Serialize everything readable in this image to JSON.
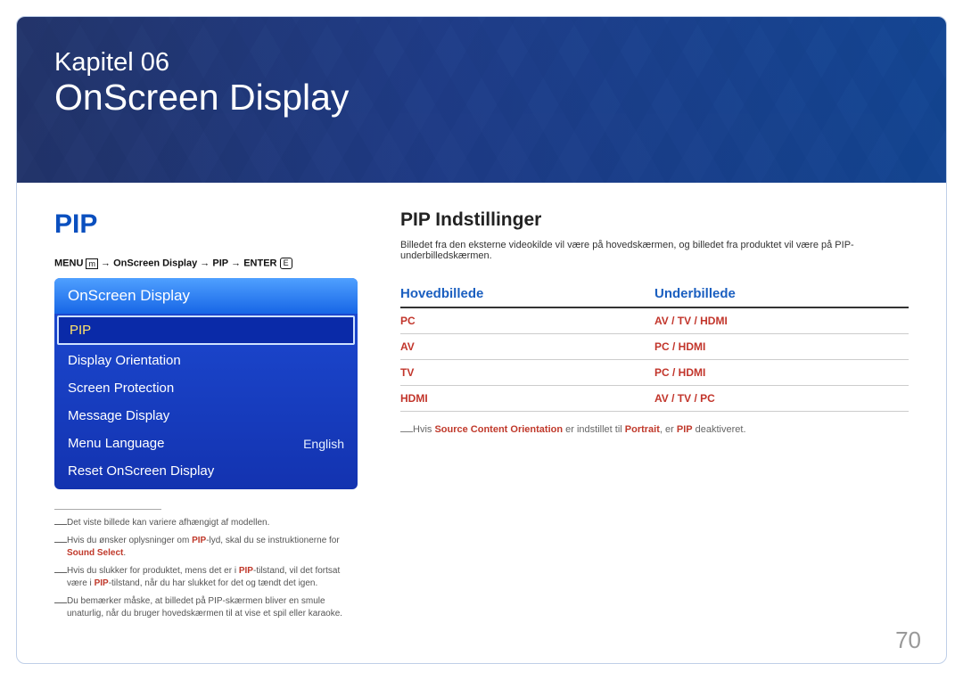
{
  "banner": {
    "chapter": "Kapitel 06",
    "title": "OnScreen Display"
  },
  "left": {
    "heading": "PIP",
    "breadcrumb": {
      "menu_label": "MENU",
      "menu_glyph": "m",
      "path1": "OnScreen Display",
      "path2": "PIP",
      "enter_label": "ENTER",
      "enter_glyph": "E"
    },
    "menu": {
      "header": "OnScreen Display",
      "items": [
        {
          "label": "PIP",
          "selected": true
        },
        {
          "label": "Display Orientation"
        },
        {
          "label": "Screen Protection"
        },
        {
          "label": "Message Display"
        },
        {
          "label": "Menu Language",
          "value": "English"
        },
        {
          "label": "Reset OnScreen Display"
        }
      ]
    },
    "footnotes": [
      {
        "text": "Det viste billede kan variere afhængigt af modellen."
      },
      {
        "parts": [
          "Hvis du ønsker oplysninger om ",
          {
            "hl": "PIP"
          },
          "-lyd, skal du se instruktionerne for ",
          {
            "hl": "Sound Select"
          },
          "."
        ]
      },
      {
        "parts": [
          "Hvis du slukker for produktet, mens det er i ",
          {
            "hl": "PIP"
          },
          "-tilstand, vil det fortsat være i ",
          {
            "hl": "PIP"
          },
          "-tilstand, når du har slukket for det og tændt det igen."
        ]
      },
      {
        "text": "Du bemærker måske, at billedet på PIP-skærmen bliver en smule unaturlig, når du bruger hovedskærmen til at vise et spil eller karaoke."
      }
    ]
  },
  "right": {
    "title": "PIP Indstillinger",
    "desc": "Billedet fra den eksterne videokilde vil være på hovedskærmen, og billedet fra produktet vil være på PIP-underbilledskærmen.",
    "table": {
      "col1": "Hovedbillede",
      "col2": "Underbillede",
      "rows": [
        {
          "main": "PC",
          "sub": "AV / TV / HDMI"
        },
        {
          "main": "AV",
          "sub": "PC / HDMI"
        },
        {
          "main": "TV",
          "sub": "PC / HDMI"
        },
        {
          "main": "HDMI",
          "sub": "AV / TV / PC"
        }
      ]
    },
    "note": {
      "parts": [
        "Hvis ",
        {
          "hl": "Source Content Orientation"
        },
        " er indstillet til ",
        {
          "hl": "Portrait"
        },
        ", er ",
        {
          "hl": "PIP"
        },
        " deaktiveret."
      ]
    }
  },
  "page_number": "70"
}
